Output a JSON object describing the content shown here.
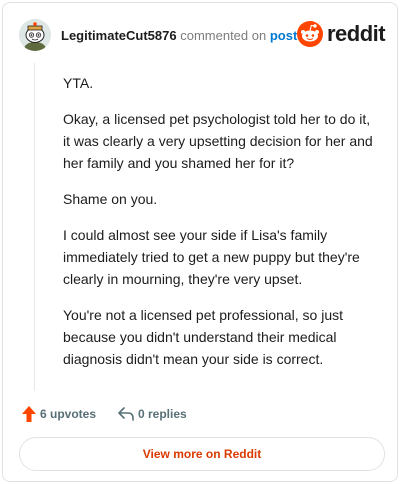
{
  "header": {
    "username": "LegitimateCut5876",
    "commented_text": "commented on",
    "post_link": "post",
    "logo_text": "reddit",
    "avatar_icon": "snoo-avatar-icon",
    "brand_color": "#ff4500"
  },
  "comment": {
    "paragraphs": [
      "YTA.",
      "Okay, a licensed pet psychologist told her to do it, it was clearly a very upsetting decision for her and her family and you shamed her for it?",
      "Shame on you.",
      "I could almost see your side if Lisa's family immediately tried to get a new puppy but they're clearly in mourning, they're very upset.",
      "You're not a licensed pet professional, so just because you didn't understand their medical diagnosis didn't mean your side is correct."
    ]
  },
  "actions": {
    "upvotes_label": "6 upvotes",
    "upvote_icon": "upvote-arrow-icon",
    "replies_label": "0 replies",
    "reply_icon": "reply-arrow-icon"
  },
  "footer": {
    "view_button_label": "View more on Reddit",
    "accent_color": "#d93a00"
  }
}
